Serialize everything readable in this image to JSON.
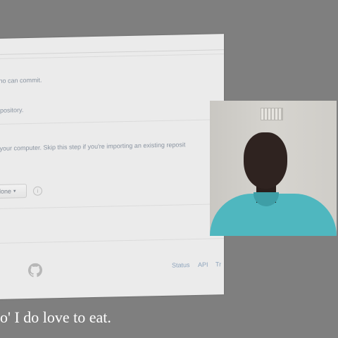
{
  "browser": {
    "texts": {
      "line1": "who can commit.",
      "line2": "repository.",
      "line3": "o your computer. Skip this step if you're importing an existing reposit"
    },
    "clone_button": {
      "label": "lone",
      "caret": "▾"
    },
    "footer": {
      "links": [
        "Status",
        "API",
        "Tr"
      ]
    }
  },
  "caption": {
    "text": "o' I do love to eat."
  }
}
